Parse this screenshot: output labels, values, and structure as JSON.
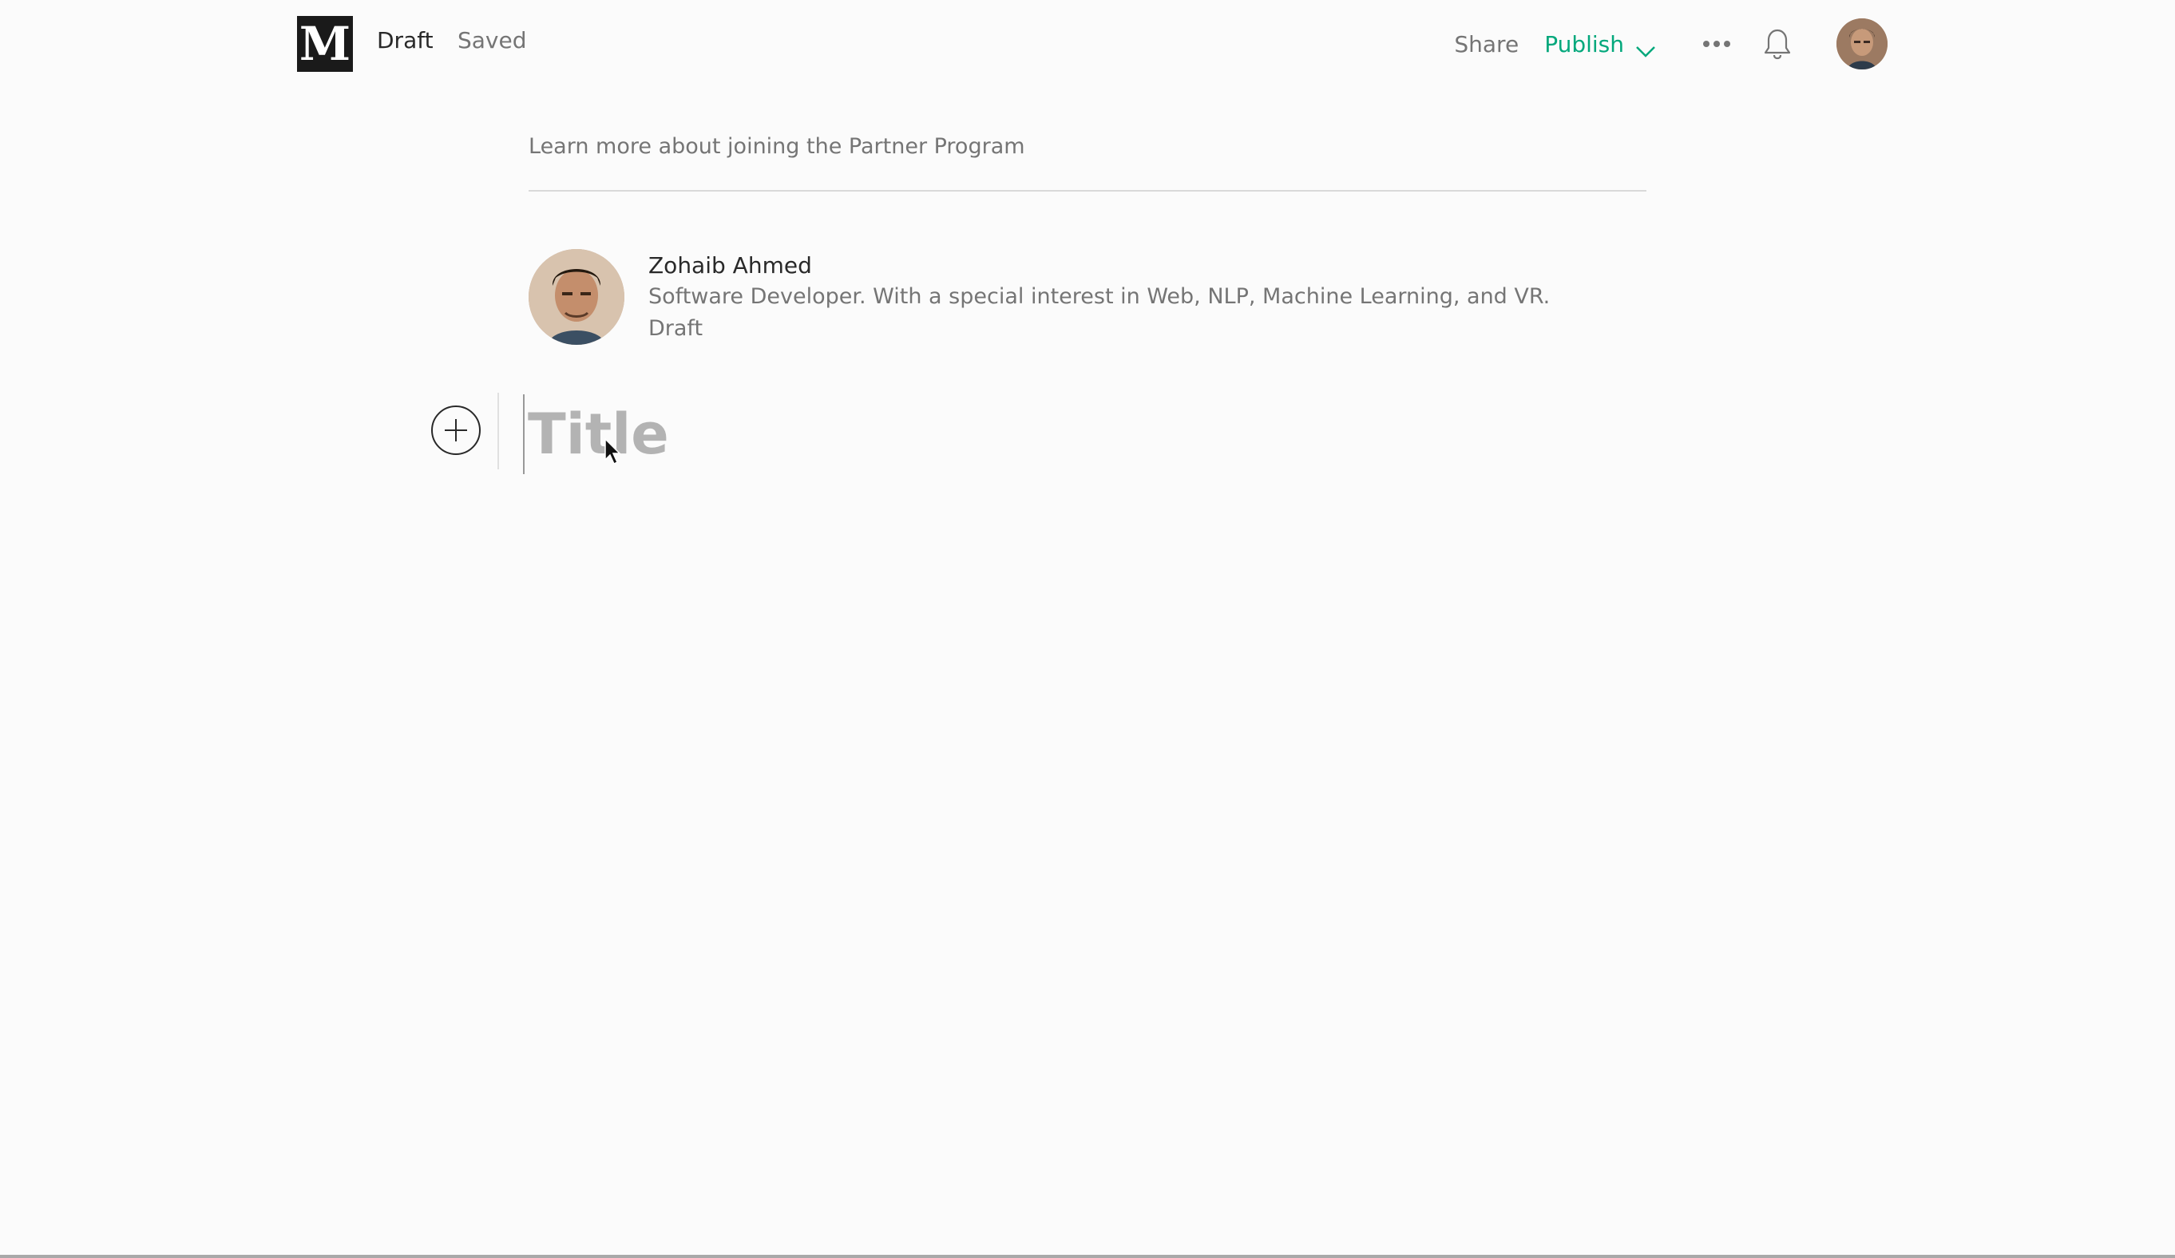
{
  "header": {
    "logo_letter": "M",
    "status": "Draft",
    "save_state": "Saved",
    "share_label": "Share",
    "publish_label": "Publish",
    "accent_color": "#03a87c"
  },
  "partner": {
    "link_text": "Learn more about joining the Partner Program"
  },
  "author": {
    "name": "Zohaib Ahmed",
    "bio": "Software Developer. With a special interest in Web, NLP, Machine Learning, and VR.",
    "state": "Draft"
  },
  "editor": {
    "title_placeholder": "Title"
  },
  "icons": {
    "add": "plus-circle-icon",
    "more": "more-horizontal-icon",
    "notifications": "bell-icon",
    "publish_menu": "chevron-down-icon"
  }
}
